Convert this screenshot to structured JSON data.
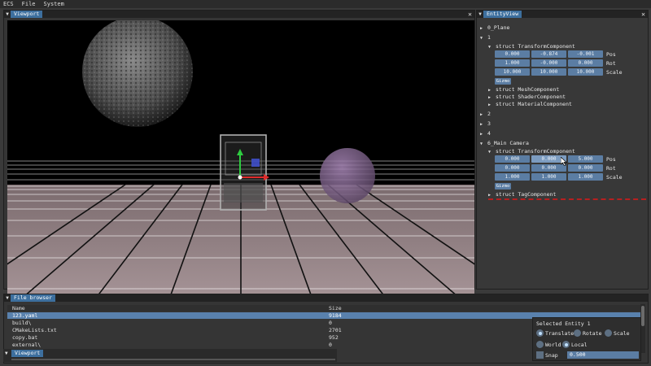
{
  "menu": [
    "ECS",
    "File",
    "System"
  ],
  "viewport": {
    "tab": "Viewport",
    "close": "✕"
  },
  "entity_view": {
    "tab": "EntityView",
    "close": "✕",
    "entities": [
      {
        "label": "0_Plane",
        "expanded": false
      },
      {
        "label": "1",
        "expanded": true
      },
      {
        "label": "2",
        "expanded": false
      },
      {
        "label": "3",
        "expanded": false
      },
      {
        "label": "4",
        "expanded": false
      },
      {
        "label": "6_Main Camera",
        "expanded": true
      }
    ],
    "entity1": {
      "transform": "struct TransformComponent",
      "pos": [
        "0.000",
        "-0.874",
        "-0.001"
      ],
      "rot": [
        "1.000",
        "-0.000",
        "0.000"
      ],
      "scale": [
        "10.000",
        "10.000",
        "10.000"
      ],
      "labels": [
        "Pos",
        "Rot",
        "Scale"
      ],
      "gizmo": "Gizmo",
      "other": [
        "struct MeshComponent",
        "struct ShaderComponent",
        "struct MaterialComponent"
      ]
    },
    "camera": {
      "transform": "struct TransformComponent",
      "pos": [
        "0.000",
        "0.000",
        "5.000"
      ],
      "rot": [
        "0.000",
        "0.000",
        "0.000"
      ],
      "scale": [
        "1.000",
        "1.000",
        "1.000"
      ],
      "labels": [
        "Pos",
        "Rot",
        "Scale"
      ],
      "gizmo": "Gizmo",
      "other": [
        "struct TagComponent"
      ]
    }
  },
  "file_browser": {
    "tab": "File browser",
    "columns": [
      "Name",
      "Size"
    ],
    "rows": [
      {
        "name": "123.yaml",
        "size": "9184",
        "selected": true
      },
      {
        "name": "build\\",
        "size": "0",
        "selected": false
      },
      {
        "name": "CMakeLists.txt",
        "size": "2701",
        "selected": false
      },
      {
        "name": "copy.bat",
        "size": "952",
        "selected": false
      },
      {
        "name": "external\\",
        "size": "0",
        "selected": false
      }
    ]
  },
  "mini_viewport": {
    "tab": "Viewport"
  },
  "selected_entity": {
    "title": "Selected Entity 1",
    "modes": [
      "Translate",
      "Rotate",
      "Scale"
    ],
    "active_mode": "Translate",
    "spaces": [
      "World",
      "Local"
    ],
    "active_space": "Local",
    "snap_label": "Snap",
    "snap_value": "0.500",
    "snap_checked": false
  },
  "colors": {
    "accent": "#3d6f9e",
    "field": "#5b7da3",
    "error": "#b62020"
  }
}
